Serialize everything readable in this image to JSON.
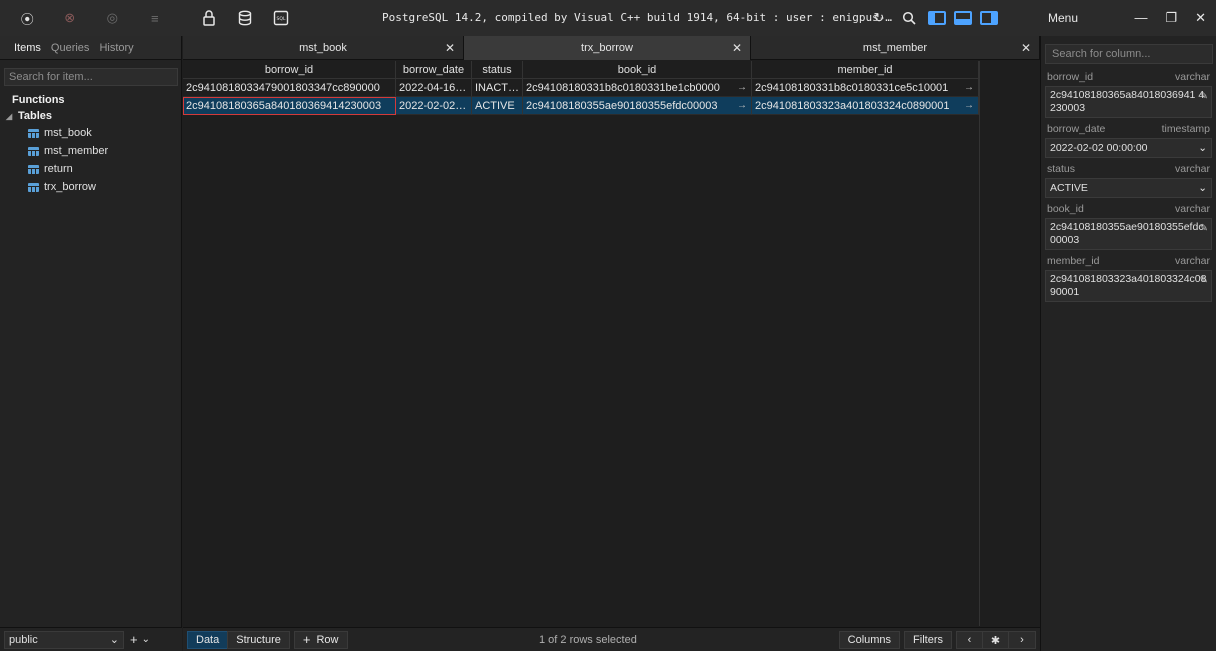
{
  "titlebar": {
    "title": "PostgreSQL 14.2, compiled by Visual C++ build 1914, 64-bit : user : enigpus-…",
    "menu_label": "Menu"
  },
  "sidebar": {
    "tabs": [
      "Items",
      "Queries",
      "History"
    ],
    "search_placeholder": "Search for item...",
    "functions_label": "Functions",
    "tables_label": "Tables",
    "tables": [
      "mst_book",
      "mst_member",
      "return",
      "trx_borrow"
    ],
    "schema": "public"
  },
  "tabs": [
    {
      "label": "mst_book"
    },
    {
      "label": "trx_borrow"
    },
    {
      "label": "mst_member"
    }
  ],
  "grid": {
    "columns": [
      "borrow_id",
      "borrow_date",
      "status",
      "book_id",
      "member_id"
    ],
    "rows": [
      [
        "2c94108180334790018033­47cc890000",
        "2022-04-16 0...",
        "INACTIVE",
        "2c94108180331b8c0180331be1cb0000",
        "2c94108180331b8c0180331ce5c10001"
      ],
      [
        "2c94108180365a8401803694142300­03",
        "2022-02-02 0...",
        "ACTIVE",
        "2c94108180355ae90180355efdc00003",
        "2c941081803323a401803324c0890001"
      ]
    ]
  },
  "bottombar": {
    "data_label": "Data",
    "structure_label": "Structure",
    "row_label": "Row",
    "status": "1 of 2 rows selected",
    "columns_label": "Columns",
    "filters_label": "Filters"
  },
  "rpanel": {
    "search_placeholder": "Search for column...",
    "fields": [
      {
        "name": "borrow_id",
        "type": "varchar",
        "value": "2c94108180365a84018036941 4230003"
      },
      {
        "name": "borrow_date",
        "type": "timestamp",
        "value": "2022-02-02 00:00:00"
      },
      {
        "name": "status",
        "type": "varchar",
        "value": "ACTIVE"
      },
      {
        "name": "book_id",
        "type": "varchar",
        "value": "2c94108180355ae90180355efdc 00003"
      },
      {
        "name": "member_id",
        "type": "varchar",
        "value": "2c941081803323a401803324c08 90001"
      }
    ]
  }
}
